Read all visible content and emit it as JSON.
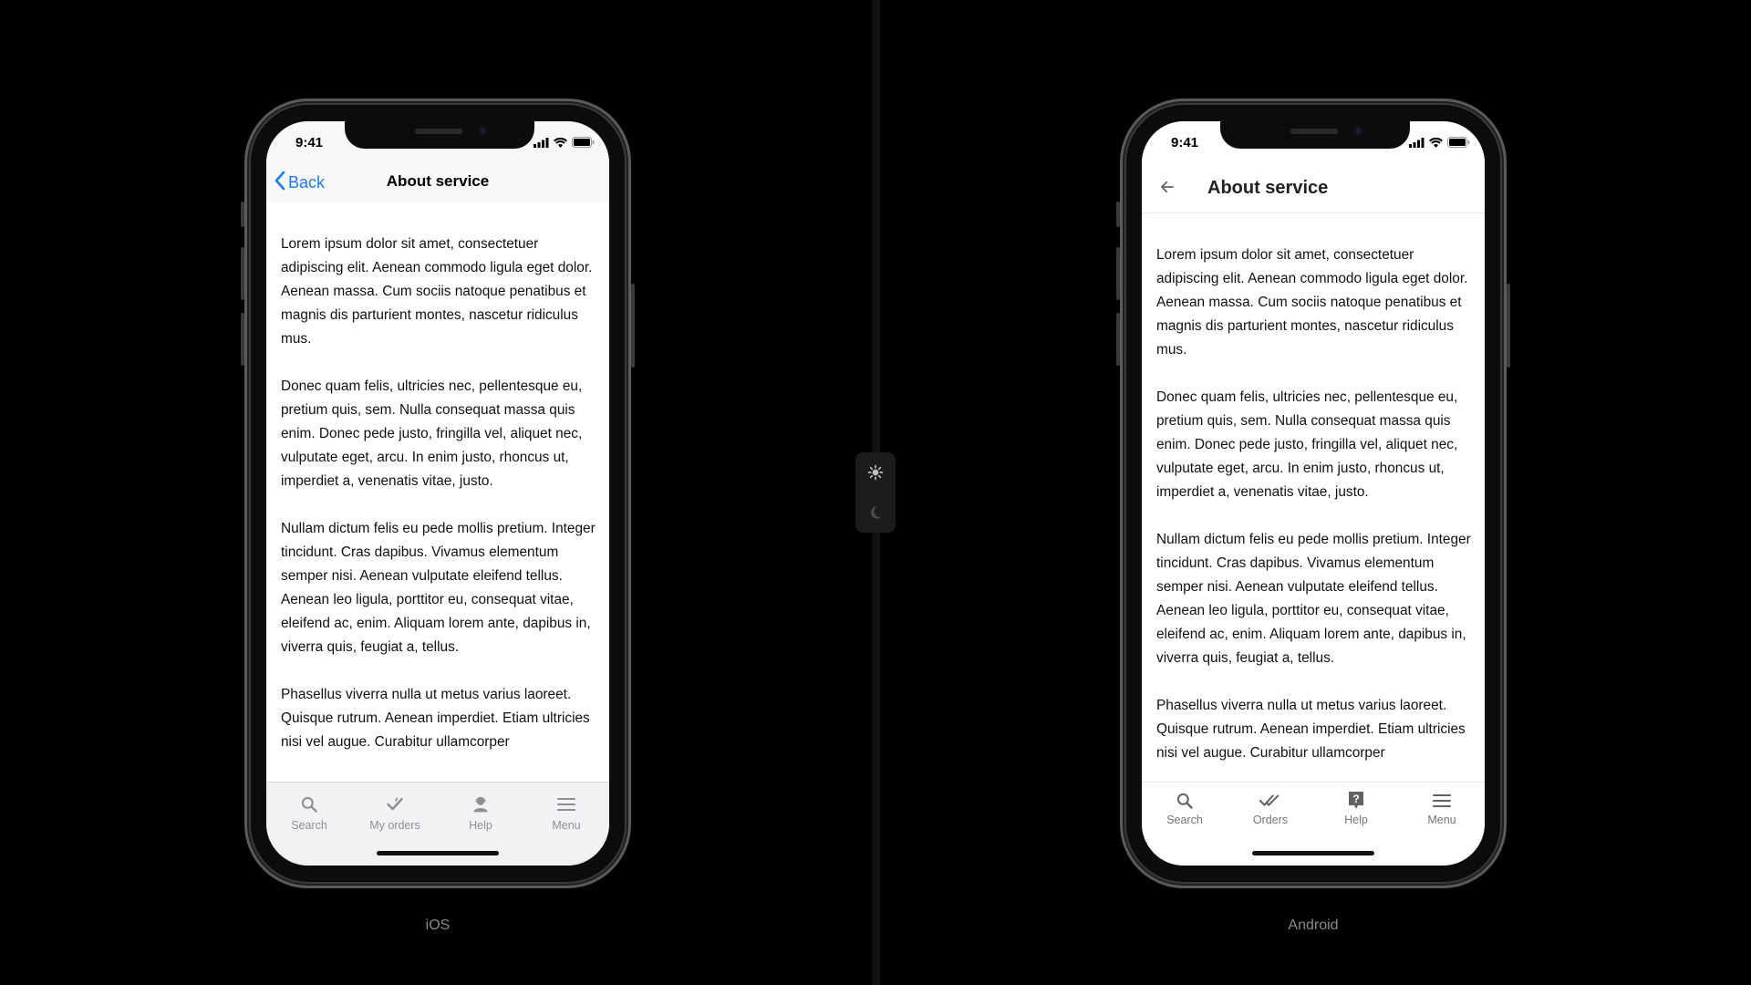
{
  "theme_toggle": {
    "light_icon": "sun-icon",
    "dark_icon": "moon-icon"
  },
  "ios": {
    "caption": "iOS",
    "status": {
      "time": "9:41"
    },
    "nav": {
      "back_label": "Back",
      "title": "About service"
    },
    "paragraphs": [
      "Lorem ipsum dolor sit amet, consectetuer adipiscing elit. Aenean commodo ligula eget dolor. Aenean massa. Cum sociis natoque penatibus et magnis dis parturient montes, nascetur ridiculus mus.",
      "Donec quam felis, ultricies nec, pellentesque eu, pretium quis, sem. Nulla consequat massa quis enim. Donec pede justo, fringilla vel, aliquet nec, vulputate eget, arcu. In enim justo, rhoncus ut, imperdiet a, venenatis vitae, justo.",
      "Nullam dictum felis eu pede mollis pretium. Integer tincidunt. Cras dapibus. Vivamus elementum semper nisi. Aenean vulputate eleifend tellus. Aenean leo ligula, porttitor eu, consequat vitae, eleifend ac, enim. Aliquam lorem ante, dapibus in, viverra quis, feugiat a, tellus.",
      "Phasellus viverra nulla ut metus varius laoreet. Quisque rutrum. Aenean imperdiet. Etiam ultricies nisi vel augue. Curabitur ullamcorper"
    ],
    "tabs": [
      {
        "label": "Search",
        "icon": "search-icon"
      },
      {
        "label": "My orders",
        "icon": "check-icon"
      },
      {
        "label": "Help",
        "icon": "support-agent-icon"
      },
      {
        "label": "Menu",
        "icon": "menu-icon"
      }
    ]
  },
  "android": {
    "caption": "Android",
    "status": {
      "time": "9:41"
    },
    "appbar": {
      "title": "About service"
    },
    "paragraphs": [
      "Lorem ipsum dolor sit amet, consectetuer adipiscing elit. Aenean commodo ligula eget dolor. Aenean massa. Cum sociis natoque penatibus et magnis dis parturient montes, nascetur ridiculus mus.",
      "Donec quam felis, ultricies nec, pellentesque eu, pretium quis, sem. Nulla consequat massa quis enim. Donec pede justo, fringilla vel, aliquet nec, vulputate eget, arcu. In enim justo, rhoncus ut, imperdiet a, venenatis vitae, justo.",
      "Nullam dictum felis eu pede mollis pretium. Integer tincidunt. Cras dapibus. Vivamus elementum semper nisi. Aenean vulputate eleifend tellus. Aenean leo ligula, porttitor eu, consequat vitae, eleifend ac, enim. Aliquam lorem ante, dapibus in, viverra quis, feugiat a, tellus.",
      "Phasellus viverra nulla ut metus varius laoreet. Quisque rutrum. Aenean imperdiet. Etiam ultricies nisi vel augue. Curabitur ullamcorper"
    ],
    "tabs": [
      {
        "label": "Search",
        "icon": "search-icon"
      },
      {
        "label": "Orders",
        "icon": "done-all-icon"
      },
      {
        "label": "Help",
        "icon": "help-icon"
      },
      {
        "label": "Menu",
        "icon": "menu-icon"
      }
    ]
  },
  "colors": {
    "ios_accent": "#1a7cf0",
    "background": "#000000"
  }
}
